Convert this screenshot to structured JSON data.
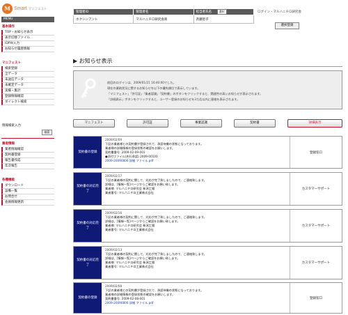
{
  "logo": {
    "mark": "M",
    "name": "Smart",
    "tagline": "マニフェスト"
  },
  "menu_header": "MENU",
  "sidebar": {
    "sections": [
      {
        "title": "基本操作",
        "items": [
          "TOP・お知らせ表示",
          "表示切替ファイル",
          "IDPW入力",
          "お知らせ履歴情報"
        ]
      },
      {
        "title": "マニフェスト",
        "items": [
          "検索登録",
          "全データ",
          "未送信データ",
          "未確定データ",
          "実績・集計",
          "登録情報確認",
          "ダイレクト検索"
        ]
      },
      {
        "title": "情報検索入力",
        "items": []
      },
      {
        "title": "業者情報",
        "items": [
          "業者情報確認",
          "契約書登録",
          "報告書作成",
          "年次報告"
        ]
      },
      {
        "title": "各種機能",
        "items": [
          "ダウンロード",
          "設備一覧",
          "お問合せ",
          "会員情報更新"
        ]
      }
    ],
    "search_button": "検索"
  },
  "user_table": {
    "headers": [
      "管理者ID",
      "管理者名",
      "担当者氏名"
    ],
    "header_button": "選択",
    "values": [
      "ホクシンアント",
      "マルハニチロ研究会商",
      "斉藤智子"
    ]
  },
  "user_links": "ログイン・マルハニチロ研究会",
  "user_button": "選択登録",
  "notice_heading": "▶ お知らせ表示",
  "info_lines": [
    "前回のログインは、2009/01/21 16:40:00でした。",
    "現在の業務状況に関するお知らせを以下の優先順位で表示しています。",
    "「マニフェスト」「許可証」「業者認識」「契約書」のボタンをクリックすると、関連性の高いお知らせが表示されます。",
    "「詳細表示」ボタンをクリックすると、ユーザー登録のお知らせを3カ月以内に連絡を表示されます。"
  ],
  "tabs": [
    "マニフェスト",
    "許可証",
    "事業認識",
    "契約書",
    "詳細表示"
  ],
  "active_tab": "詳細表示",
  "notices": [
    {
      "label": "契約書の登録",
      "date": "2009/02/09",
      "lines": [
        "下記の業者様との契約書が登録されて、承認待機の状態になっております。",
        "業者様の詳細情報の登録状態の確認をお願いします。",
        "契約書番号: 2009-02-09-001",
        "●添付ファイル(先行承認) 2009-00100"
      ],
      "link": "2009-20090806 詳細 ファイル.pdf",
      "dest": "登録窓口"
    },
    {
      "label": "契約書の対応完了",
      "date": "2009/02/17",
      "lines": [
        "下記の業者様の契約に関して、対応が完了致しましたので、ご連絡致します。",
        "詳細は、[情報一覧]ページからご確認をお願い致します。",
        "業者様: マルハニチロ研究会 新潟工場",
        "業者番号: マルハニチロ工業株式会社"
      ],
      "link": "",
      "dest": "カスタマーサポート"
    },
    {
      "label": "契約書の対応完了",
      "date": "2009/02/16",
      "lines": [
        "下記の業者様の契約に関して、対応が完了致しましたので、ご連絡致します。",
        "詳細は、[情報一覧]ページからご確認をお願い致します。",
        "業者様: マルハニチロ研究会 新潟工場",
        "業者番号: マルハニチロ工業株式会社"
      ],
      "link": "",
      "dest": "カスタマーサポート"
    },
    {
      "label": "契約書の対応完了",
      "date": "2009/02/13",
      "lines": [
        "下記の業者様の契約に関して、対応が完了致しましたので、ご連絡致します。",
        "詳細は、[情報一覧]ページからご確認をお願い致します。",
        "業者様: マルハニチロ研究会 新潟工場",
        "業者番号: マルハニチロ工業株式会社"
      ],
      "link": "",
      "dest": "カスタマーサポート"
    },
    {
      "label": "契約書の登録",
      "date": "2009/02/08",
      "lines": [
        "下記の業者様との契約書が登録されて、承認待機の状態になっております。",
        "業者様の詳細情報の登録状態の確認をお願いします。",
        "契約書番号: 2009-02-08-001"
      ],
      "link": "2009-20090806 詳細 ファイル.pdf",
      "dest": "登録窓口"
    }
  ],
  "colors": {
    "accent": "#c8102e",
    "label_bg": "#0f1a77",
    "header_bg": "#5a5a5a",
    "logo": "#e8731f"
  }
}
